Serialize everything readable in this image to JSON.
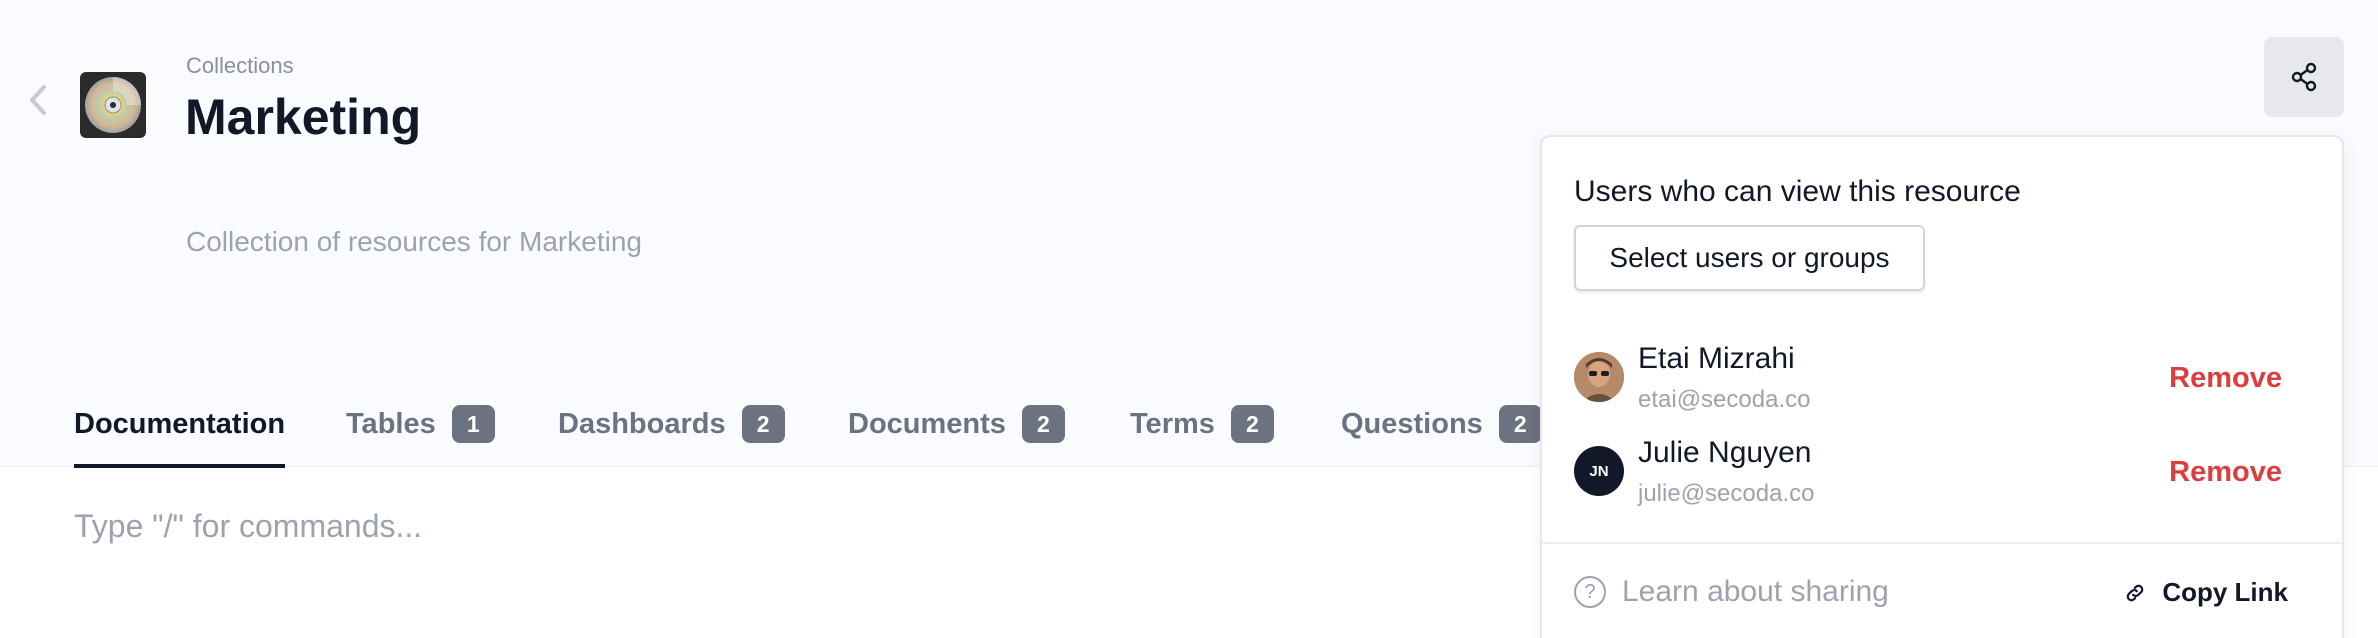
{
  "header": {
    "breadcrumb": "Collections",
    "title": "Marketing",
    "description": "Collection of resources for Marketing"
  },
  "tabs": [
    {
      "label": "Documentation",
      "count": null,
      "active": true
    },
    {
      "label": "Tables",
      "count": "1"
    },
    {
      "label": "Dashboards",
      "count": "2"
    },
    {
      "label": "Documents",
      "count": "2"
    },
    {
      "label": "Terms",
      "count": "2"
    },
    {
      "label": "Questions",
      "count": "2"
    }
  ],
  "editor": {
    "placeholder": "Type \"/\" for commands..."
  },
  "share_popover": {
    "heading": "Users who can view this resource",
    "select_button": "Select users or groups",
    "users": [
      {
        "name": "Etai Mizrahi",
        "email": "etai@secoda.co",
        "avatar": "photo",
        "remove_label": "Remove"
      },
      {
        "name": "Julie Nguyen",
        "email": "julie@secoda.co",
        "initials": "JN",
        "remove_label": "Remove"
      }
    ],
    "learn_link": "Learn about sharing",
    "copy_link": "Copy Link"
  },
  "icons": {
    "back": "chevron-left-icon",
    "collection": "cd-disc-icon",
    "share": "share-icon",
    "help": "question-circle-icon",
    "link": "link-icon"
  },
  "colors": {
    "header_bg": "#fafbff",
    "badge_bg": "#6b7280",
    "remove": "#dc3d3d",
    "text_primary": "#111827",
    "text_muted": "#9ca3af"
  }
}
